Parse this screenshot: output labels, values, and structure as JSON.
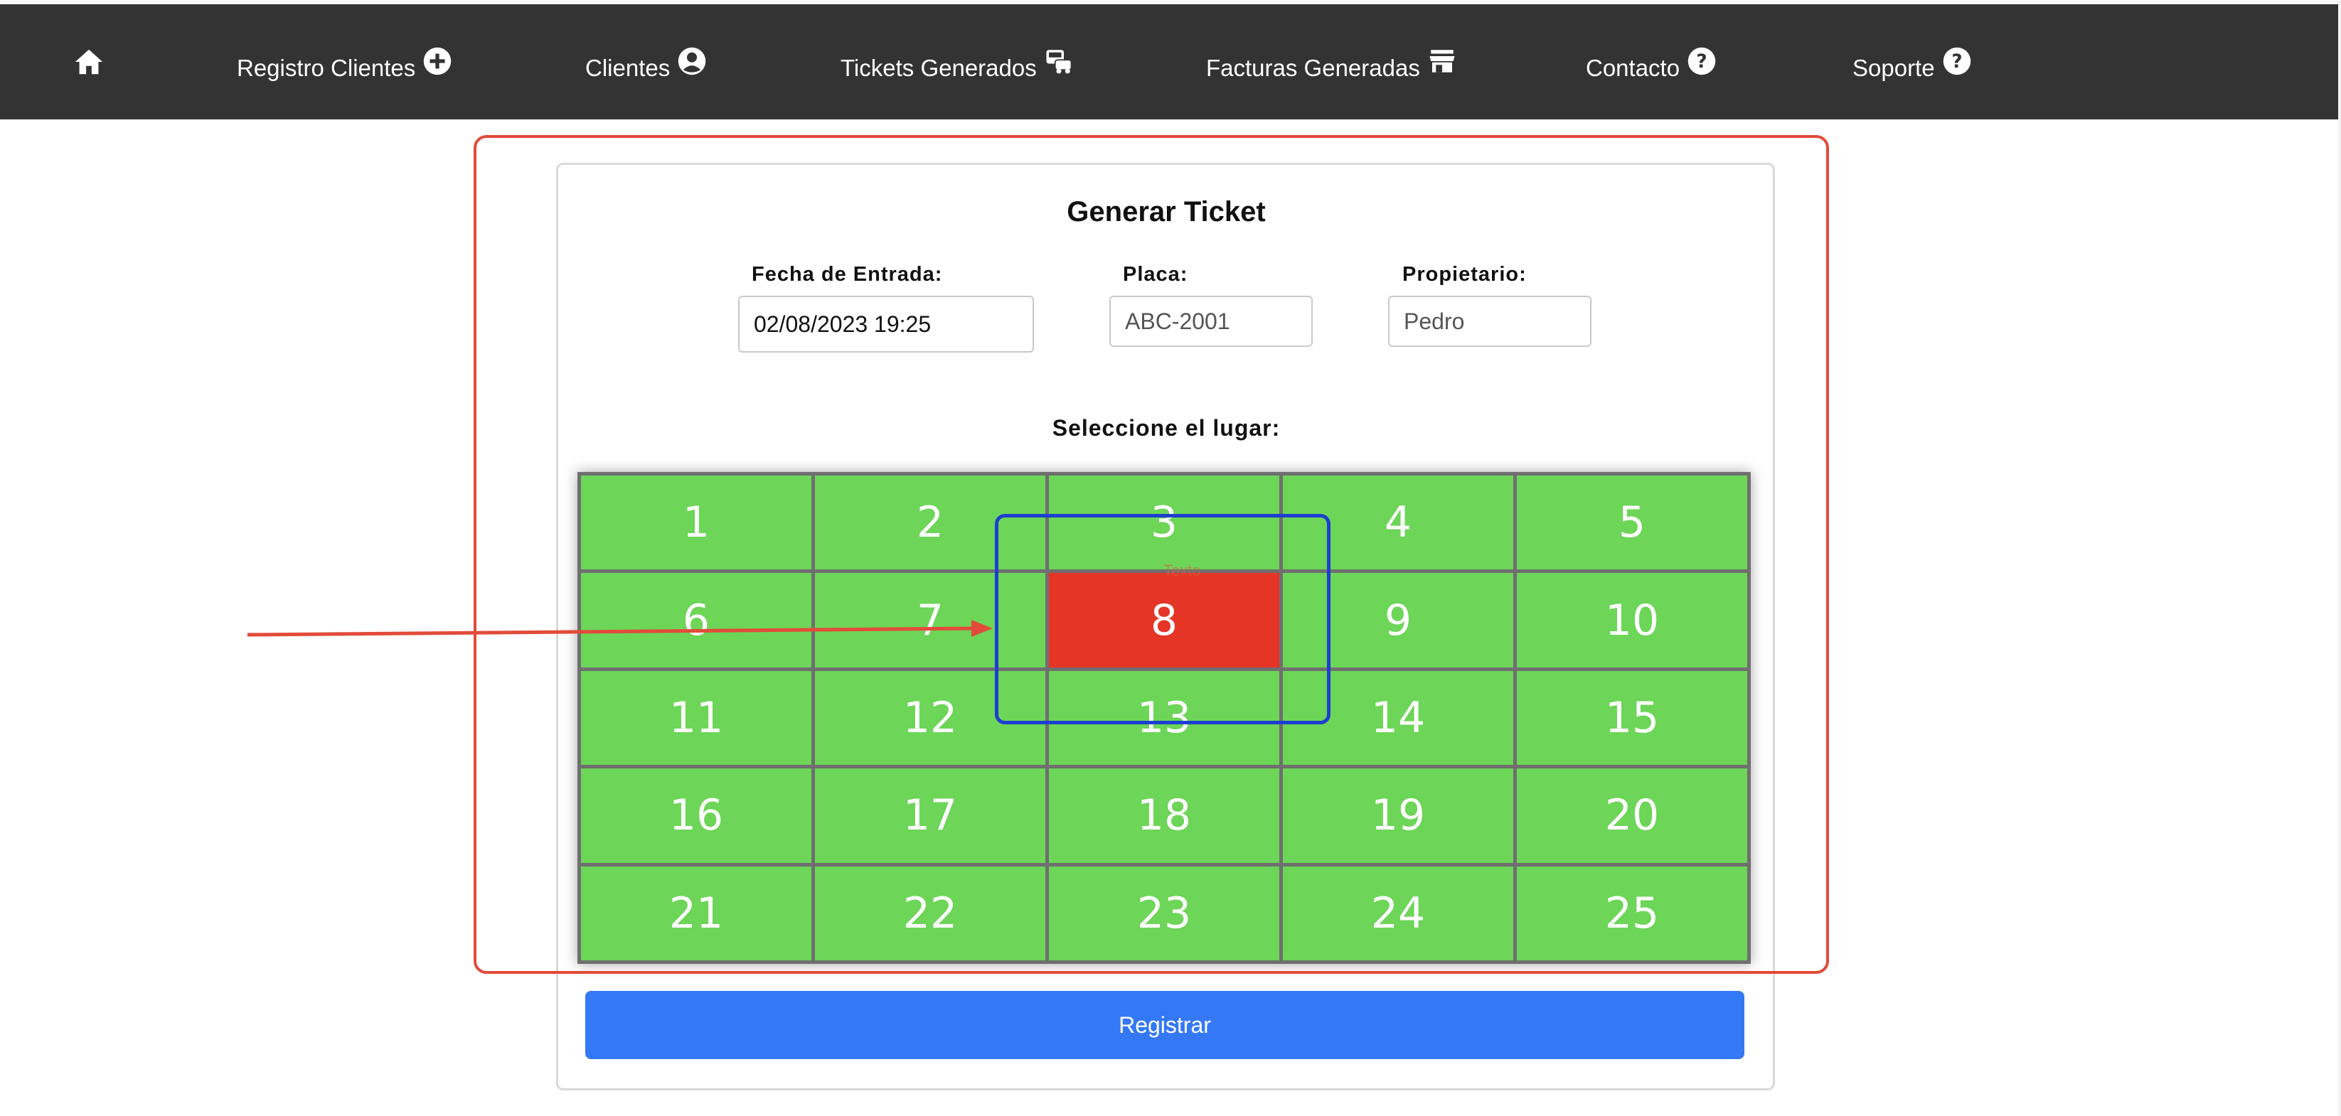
{
  "nav": {
    "home_icon": "home-icon",
    "items": [
      {
        "label": "Registro Clientes",
        "icon": "plus-circle-icon"
      },
      {
        "label": "Clientes",
        "icon": "user-circle-icon"
      },
      {
        "label": "Tickets Generados",
        "icon": "car-ticket-icon"
      },
      {
        "label": "Facturas Generadas",
        "icon": "store-icon"
      },
      {
        "label": "Contacto",
        "icon": "question-circle-icon"
      },
      {
        "label": "Soporte",
        "icon": "question-circle-icon"
      }
    ]
  },
  "form": {
    "title": "Generar Ticket",
    "fecha_label": "Fecha de Entrada:",
    "fecha_value": "02/08/2023 19:25",
    "placa_label": "Placa:",
    "placa_value": "ABC-2001",
    "propietario_label": "Propietario:",
    "propietario_value": "Pedro",
    "select_label": "Seleccione el lugar:",
    "submit_label": "Registrar"
  },
  "parking": {
    "slots": [
      "1",
      "2",
      "3",
      "4",
      "5",
      "6",
      "7",
      "8",
      "9",
      "10",
      "11",
      "12",
      "13",
      "14",
      "15",
      "16",
      "17",
      "18",
      "19",
      "20",
      "21",
      "22",
      "23",
      "24",
      "25"
    ],
    "occupied": [
      "8"
    ],
    "ghost_text": "Texto",
    "colors": {
      "free": "#6dd558",
      "occupied": "#e53526",
      "grid_line": "#6f6f6f"
    }
  },
  "annotations": {
    "outer_frame_color": "#e24b3a",
    "arrow_color": "#e24b3a",
    "highlight_box_color": "#1d3fd1"
  }
}
